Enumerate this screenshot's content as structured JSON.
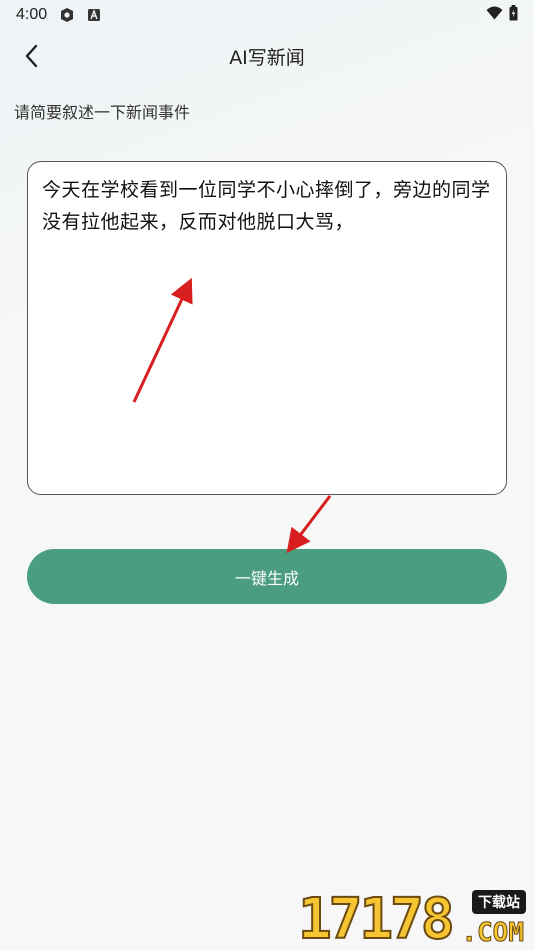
{
  "status_bar": {
    "time": "4:00",
    "icons": [
      "settings-shield-icon",
      "notification-a-icon"
    ],
    "right_icons": [
      "wifi-icon",
      "battery-icon"
    ]
  },
  "header": {
    "back_icon": "chevron-left-icon",
    "title": "AI写新闻"
  },
  "form": {
    "prompt_label": "请简要叙述一下新闻事件",
    "textarea_value": "今天在学校看到一位同学不小心摔倒了，旁边的同学没有拉他起来，反而对他脱口大骂，",
    "generate_label": "一键生成"
  },
  "watermark": {
    "number": "17178",
    "badge": "下载站",
    "suffix": ".COM"
  },
  "colors": {
    "accent": "#4a9e7f",
    "annotation_arrow": "#d81e1e",
    "background": "#f7f7f7"
  }
}
